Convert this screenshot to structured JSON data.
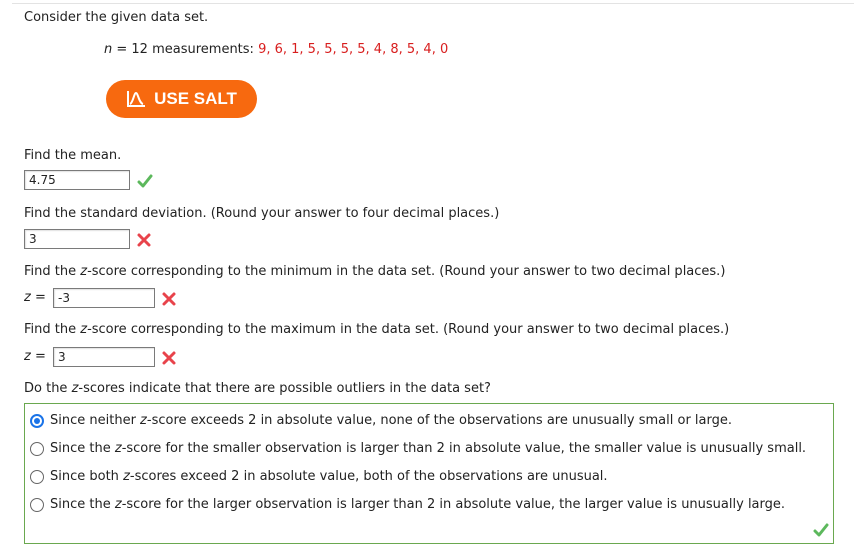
{
  "intro": "Consider the given data set.",
  "dataset": {
    "n_var": "n",
    "n_rest": " = 12 measurements: ",
    "values": "9, 6, 1, 5, 5, 5, 5, 4, 8, 5, 4, 0"
  },
  "salt_button": {
    "label": "USE SALT"
  },
  "q1": {
    "prompt": "Find the mean.",
    "answer": "4.75",
    "status": "correct"
  },
  "q2": {
    "prompt": "Find the standard deviation. (Round your answer to four decimal places.)",
    "answer": "3",
    "status": "incorrect"
  },
  "q3": {
    "prompt_pre": "Find the ",
    "prompt_z": "z",
    "prompt_post": "-score corresponding to the minimum in the data set. (Round your answer to two decimal places.)",
    "label_z": "z",
    "label_eq": " = ",
    "answer": "-3",
    "status": "incorrect"
  },
  "q4": {
    "prompt_pre": "Find the ",
    "prompt_z": "z",
    "prompt_post": "-score corresponding to the maximum in the data set. (Round your answer to two decimal places.)",
    "label_z": "z",
    "label_eq": " = ",
    "answer": "3",
    "status": "incorrect"
  },
  "q5": {
    "prompt_pre": "Do the ",
    "prompt_z": "z",
    "prompt_post": "-scores indicate that there are possible outliers in the data set?",
    "options": [
      {
        "pre": "Since neither ",
        "z": "z",
        "post": "-score exceeds 2 in absolute value, none of the observations are unusually small or large.",
        "checked": true
      },
      {
        "pre": "Since the ",
        "z": "z",
        "post": "-score for the smaller observation is larger than 2 in absolute value, the smaller value is unusually small.",
        "checked": false
      },
      {
        "pre": "Since both ",
        "z": "z",
        "post": "-scores exceed 2 in absolute value, both of the observations are unusual.",
        "checked": false
      },
      {
        "pre": "Since the ",
        "z": "z",
        "post": "-score for the larger observation is larger than 2 in absolute value, the larger value is unusually large.",
        "checked": false
      }
    ],
    "status": "correct"
  },
  "colors": {
    "accent": "#f7690f",
    "values_red": "#d81e1e",
    "check_green": "#5cb85c",
    "cross_red": "#e8434b",
    "radio_blue": "#1a73e8",
    "box_border_green": "#6aa84f"
  }
}
